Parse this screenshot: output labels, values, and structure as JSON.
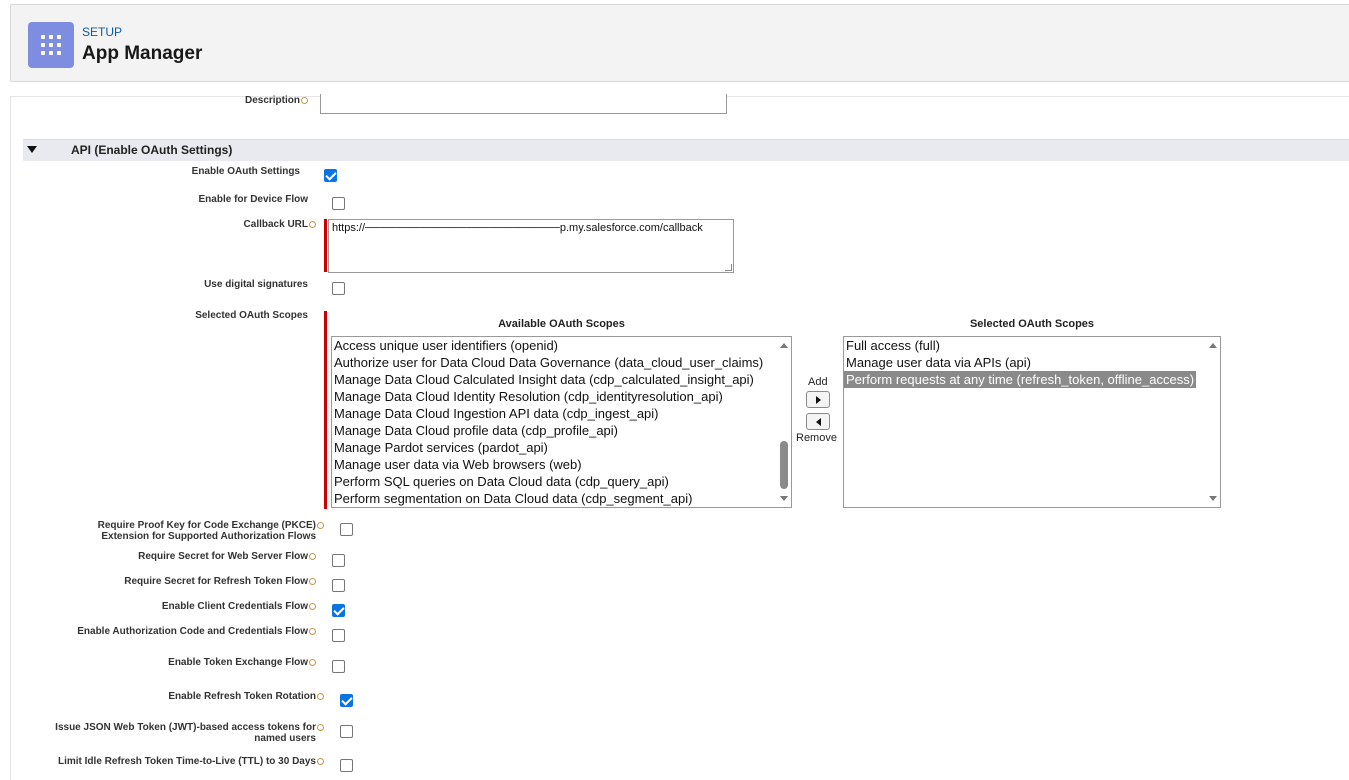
{
  "header": {
    "setup_label": "SETUP",
    "title": "App Manager",
    "icon": "app-launcher-grid-icon",
    "icon_bg": "#7f8de1"
  },
  "form": {
    "description_label": "Description",
    "section_title": "API (Enable OAuth Settings)",
    "enable_oauth": {
      "label": "Enable OAuth Settings",
      "checked": true
    },
    "device_flow": {
      "label": "Enable for Device Flow",
      "checked": false
    },
    "callback": {
      "label": "Callback URL",
      "value": "https://─────────────────────────p.my.salesforce.com/callback"
    },
    "digital_sig": {
      "label": "Use digital signatures",
      "checked": false
    },
    "scopes": {
      "label": "Selected OAuth Scopes",
      "available_heading": "Available OAuth Scopes",
      "selected_heading": "Selected OAuth Scopes",
      "available": [
        "Access unique user identifiers (openid)",
        "Authorize user for Data Cloud Data Governance (data_cloud_user_claims)",
        "Manage Data Cloud Calculated Insight data (cdp_calculated_insight_api)",
        "Manage Data Cloud Identity Resolution (cdp_identityresolution_api)",
        "Manage Data Cloud Ingestion API data (cdp_ingest_api)",
        "Manage Data Cloud profile data (cdp_profile_api)",
        "Manage Pardot services (pardot_api)",
        "Manage user data via Web browsers (web)",
        "Perform SQL queries on Data Cloud data (cdp_query_api)",
        "Perform segmentation on Data Cloud data (cdp_segment_api)"
      ],
      "selected": [
        "Full access (full)",
        "Manage user data via APIs (api)",
        "Perform requests at any time (refresh_token, offline_access)"
      ],
      "selected_highlight_index": 2,
      "add_label": "Add",
      "remove_label": "Remove"
    },
    "pkce": {
      "label_line1": "Require Proof Key for Code Exchange (PKCE)",
      "label_line2": "Extension for Supported Authorization Flows",
      "checked": false
    },
    "secret_web": {
      "label": "Require Secret for Web Server Flow",
      "checked": false
    },
    "secret_refresh": {
      "label": "Require Secret for Refresh Token Flow",
      "checked": false
    },
    "client_cred": {
      "label": "Enable Client Credentials Flow",
      "checked": true
    },
    "auth_code_cred": {
      "label": "Enable Authorization Code and Credentials Flow",
      "checked": false
    },
    "token_exchange": {
      "label": "Enable Token Exchange Flow",
      "checked": false
    },
    "refresh_rotation": {
      "label": "Enable Refresh Token Rotation",
      "checked": true
    },
    "jwt": {
      "label_line1": "Issue JSON Web Token (JWT)-based access tokens for",
      "label_line2": "named users",
      "checked": false
    },
    "idle_ttl": {
      "label": "Limit Idle Refresh Token Time-to-Live (TTL) to 30 Days",
      "checked": false
    }
  },
  "colors": {
    "accent": "#0b74e5",
    "required": "#cc0000",
    "section_bg": "#e8eaf0"
  }
}
